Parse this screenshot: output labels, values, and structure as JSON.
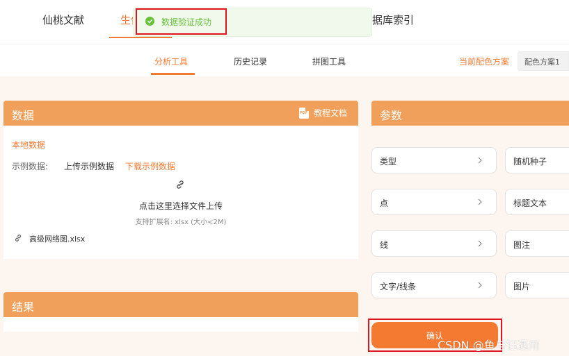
{
  "nav": {
    "items": [
      "仙桃文献",
      "生信",
      "数据库索引"
    ]
  },
  "toast": {
    "message": "数据验证成功"
  },
  "subnav": {
    "tabs": [
      "分析工具",
      "历史记录",
      "拼图工具"
    ],
    "scheme_label": "当前配色方案",
    "scheme_value": "配色方案1"
  },
  "data_panel": {
    "title": "数据",
    "doc_link": "教程文档",
    "local_data": "本地数据",
    "example_label": "示例数据:",
    "upload_example": "上传示例数据",
    "download_example": "下载示例数据",
    "upload_text": "点击这里选择文件上传",
    "upload_hint": "支持扩展名: xlsx (大小<2M)",
    "file_name": "高级网络图.xlsx"
  },
  "result_panel": {
    "title": "结果"
  },
  "param_panel": {
    "title": "参数",
    "left_buttons": [
      "类型",
      "点",
      "线",
      "文字/线条"
    ],
    "right_buttons": [
      "随机种子",
      "标题文本",
      "图注",
      "图片"
    ],
    "confirm": "确认"
  },
  "watermark": "CSDN @鱼与钰遇雨",
  "colors": {
    "accent": "#f47a32",
    "panel_header": "#f0a05a",
    "success": "#67c23a",
    "highlight_frame": "#e0141e"
  },
  "icons": [
    "check-circle-icon",
    "pdf-icon",
    "link-icon",
    "chevron-right-icon"
  ]
}
